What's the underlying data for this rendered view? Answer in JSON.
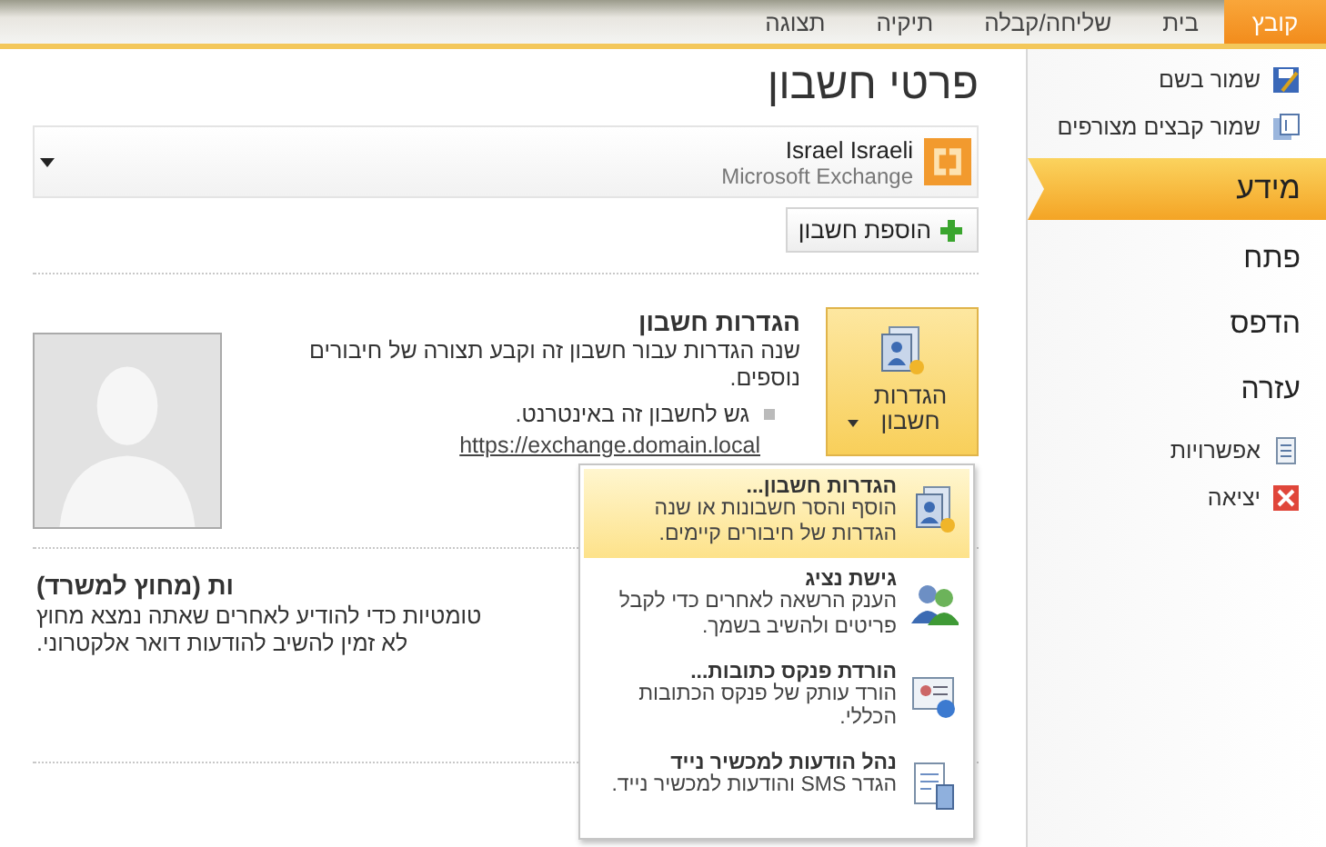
{
  "ribbon_tabs": [
    {
      "label": "קובץ",
      "selected": true
    },
    {
      "label": "בית",
      "selected": false
    },
    {
      "label": "שליחה/קבלה",
      "selected": false
    },
    {
      "label": "תיקיה",
      "selected": false
    },
    {
      "label": "תצוגה",
      "selected": false
    }
  ],
  "sidebar": {
    "items": [
      {
        "kind": "command",
        "label": "שמור בשם"
      },
      {
        "kind": "command",
        "label": "שמור קבצים מצורפים"
      },
      {
        "kind": "page",
        "label": "מידע",
        "selected": true
      },
      {
        "kind": "page",
        "label": "פתח",
        "selected": false
      },
      {
        "kind": "page",
        "label": "הדפס",
        "selected": false
      },
      {
        "kind": "page",
        "label": "עזרה",
        "selected": false
      },
      {
        "kind": "command",
        "label": "אפשרויות"
      },
      {
        "kind": "command",
        "label": "יציאה"
      }
    ]
  },
  "main": {
    "title": "פרטי חשבון",
    "account": {
      "name": "Israel Israeli",
      "type": "Microsoft Exchange"
    },
    "add_account_button": "הוספת חשבון",
    "account_settings": {
      "button_label": "הגדרות חשבון",
      "heading": "הגדרות חשבון",
      "description": "שנה הגדרות עבור חשבון זה וקבע תצורה של חיבורים נוספים.",
      "bullet": "גש לחשבון זה באינטרנט.",
      "link": "https://exchange.domain.local"
    },
    "out_of_office": {
      "heading": "ות (מחוץ למשרד)",
      "lines": [
        "טומטיות כדי להודיע לאחרים שאתה נמצא מחוץ",
        "לא זמין להשיב להודעות דואר אלקטרוני."
      ]
    }
  },
  "dropdown_menu": {
    "items": [
      {
        "title": "הגדרות חשבון...",
        "description": "הוסף והסר חשבונות או שנה הגדרות של חיבורים קיימים.",
        "selected": true
      },
      {
        "title": "גישת נציג",
        "description": "הענק הרשאה לאחרים כדי לקבל פריטים ולהשיב בשמך.",
        "selected": false
      },
      {
        "title": "הורדת פנקס כתובות...",
        "description": "הורד עותק של פנקס הכתובות הכללי.",
        "selected": false
      },
      {
        "title": "נהל הודעות למכשיר נייד",
        "description": "הגדר SMS והודעות למכשיר נייד.",
        "selected": false
      }
    ]
  }
}
